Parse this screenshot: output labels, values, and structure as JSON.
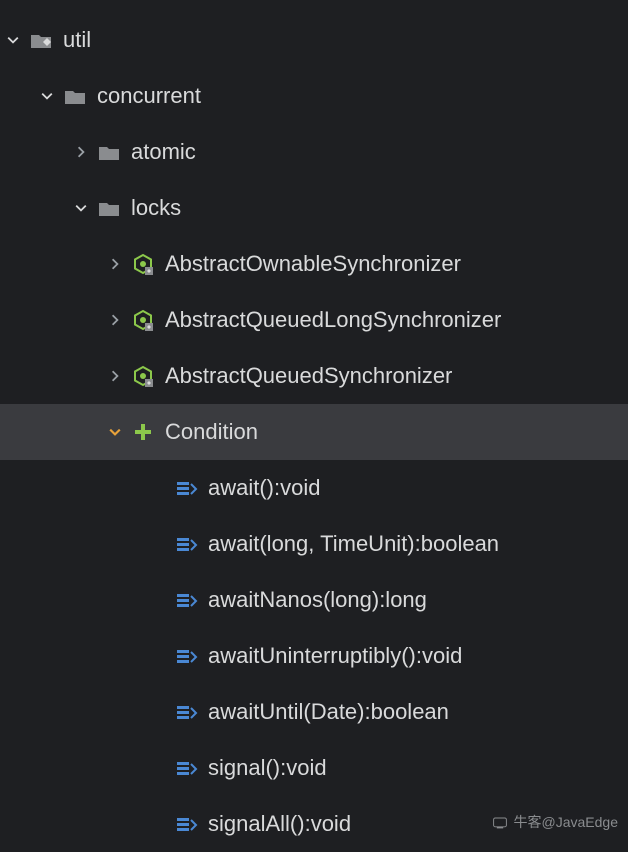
{
  "tree": {
    "util": {
      "label": "util"
    },
    "concurrent": {
      "label": "concurrent"
    },
    "atomic": {
      "label": "atomic"
    },
    "locks": {
      "label": "locks"
    },
    "classes": {
      "aos": "AbstractOwnableSynchronizer",
      "aqls": "AbstractQueuedLongSynchronizer",
      "aqs": "AbstractQueuedSynchronizer",
      "condition": "Condition"
    },
    "methods": {
      "m0": "await():void",
      "m1": "await(long, TimeUnit):boolean",
      "m2": "awaitNanos(long):long",
      "m3": "awaitUninterruptibly():void",
      "m4": "awaitUntil(Date):boolean",
      "m5": "signal():void",
      "m6": "signalAll():void"
    }
  },
  "watermark": "牛客@JavaEdge",
  "colors": {
    "bg": "#1e1f22",
    "text": "#d9dadb",
    "selected": "#3a3b3f",
    "arrow": "#9aa0a6",
    "arrowExpanded": "#d9dadb",
    "folder": "#8a8c8f",
    "classGreen": "#8cc84b",
    "interfaceGreen": "#8cc84b",
    "methodBlue": "#4a88d4"
  }
}
